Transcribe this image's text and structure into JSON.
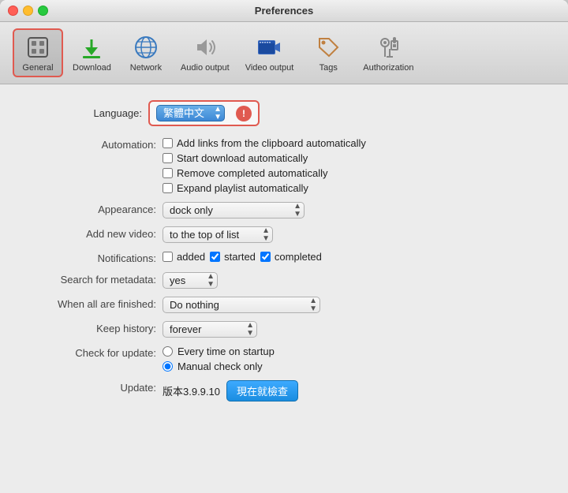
{
  "window": {
    "title": "Preferences"
  },
  "toolbar": {
    "items": [
      {
        "id": "general",
        "label": "General",
        "active": true
      },
      {
        "id": "download",
        "label": "Download",
        "active": false
      },
      {
        "id": "network",
        "label": "Network",
        "active": false
      },
      {
        "id": "audio_output",
        "label": "Audio output",
        "active": false
      },
      {
        "id": "video_output",
        "label": "Video output",
        "active": false
      },
      {
        "id": "tags",
        "label": "Tags",
        "active": false
      },
      {
        "id": "authorization",
        "label": "Authorization",
        "active": false
      }
    ]
  },
  "language": {
    "label": "Language:",
    "value": "繁體中文"
  },
  "automation": {
    "label": "Automation:",
    "options": [
      {
        "id": "add_links",
        "text": "Add links from the clipboard automatically",
        "checked": false
      },
      {
        "id": "start_download",
        "text": "Start download automatically",
        "checked": false
      },
      {
        "id": "remove_completed",
        "text": "Remove completed automatically",
        "checked": false
      },
      {
        "id": "expand_playlist",
        "text": "Expand playlist automatically",
        "checked": false
      }
    ]
  },
  "appearance": {
    "label": "Appearance:",
    "value": "dock only"
  },
  "add_new_video": {
    "label": "Add new video:",
    "value": "to the top of list"
  },
  "notifications": {
    "label": "Notifications:",
    "added": {
      "text": "added",
      "checked": false
    },
    "started": {
      "text": "started",
      "checked": true
    },
    "completed": {
      "text": "completed",
      "checked": true
    }
  },
  "search_metadata": {
    "label": "Search for metadata:",
    "value": "yes"
  },
  "when_finished": {
    "label": "When all are finished:",
    "value": "Do nothing"
  },
  "keep_history": {
    "label": "Keep history:",
    "value": "forever"
  },
  "check_update": {
    "label": "Check for update:",
    "option1": "Every time on startup",
    "option2": "Manual check only"
  },
  "update": {
    "label": "Update:",
    "version": "版本3.9.9.10",
    "button": "現在就檢查"
  }
}
